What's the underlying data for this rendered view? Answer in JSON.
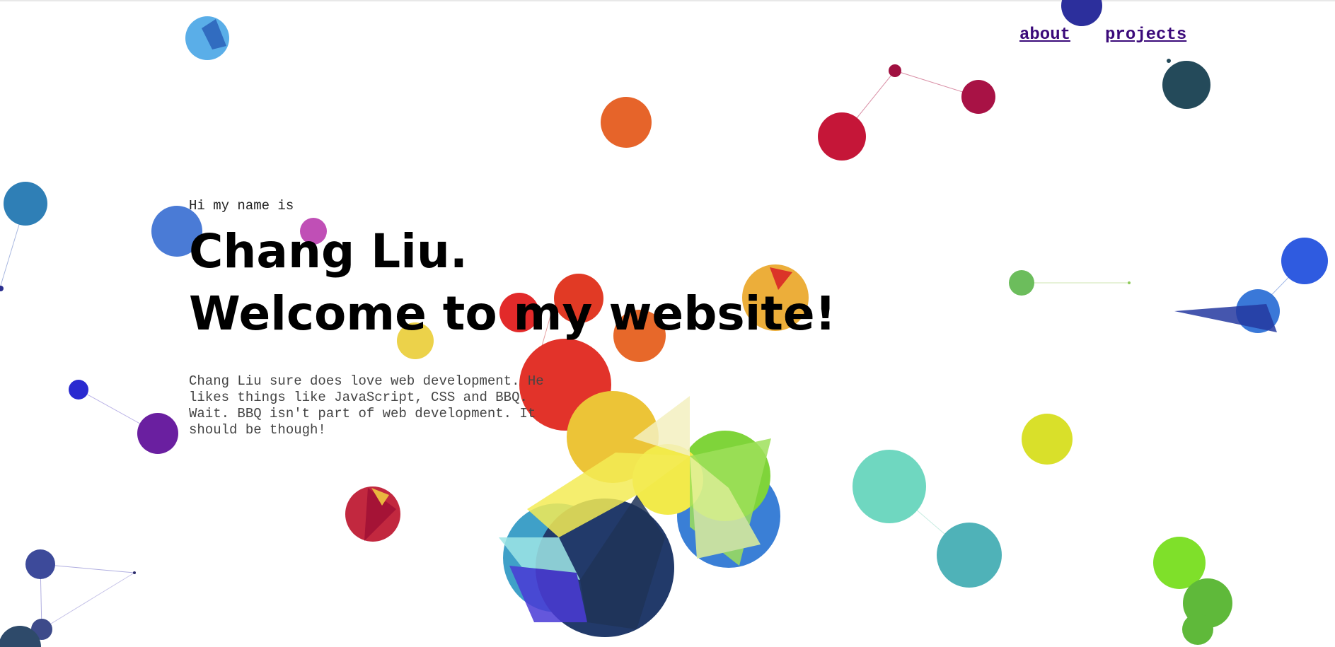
{
  "nav": {
    "about_label": "about",
    "projects_label": "projects"
  },
  "hero": {
    "greeting": "Hi my name is",
    "name": "Chang Liu.",
    "welcome": "Welcome to my website!",
    "bio": "Chang Liu sure does love web development. He likes things like JavaScript, CSS and BBQ. Wait. BBQ isn't part of web development. It should be though!"
  },
  "colors": {
    "link": "#3b0a7a",
    "text": "#000000",
    "body_text": "#444444",
    "background": "#ffffff"
  }
}
